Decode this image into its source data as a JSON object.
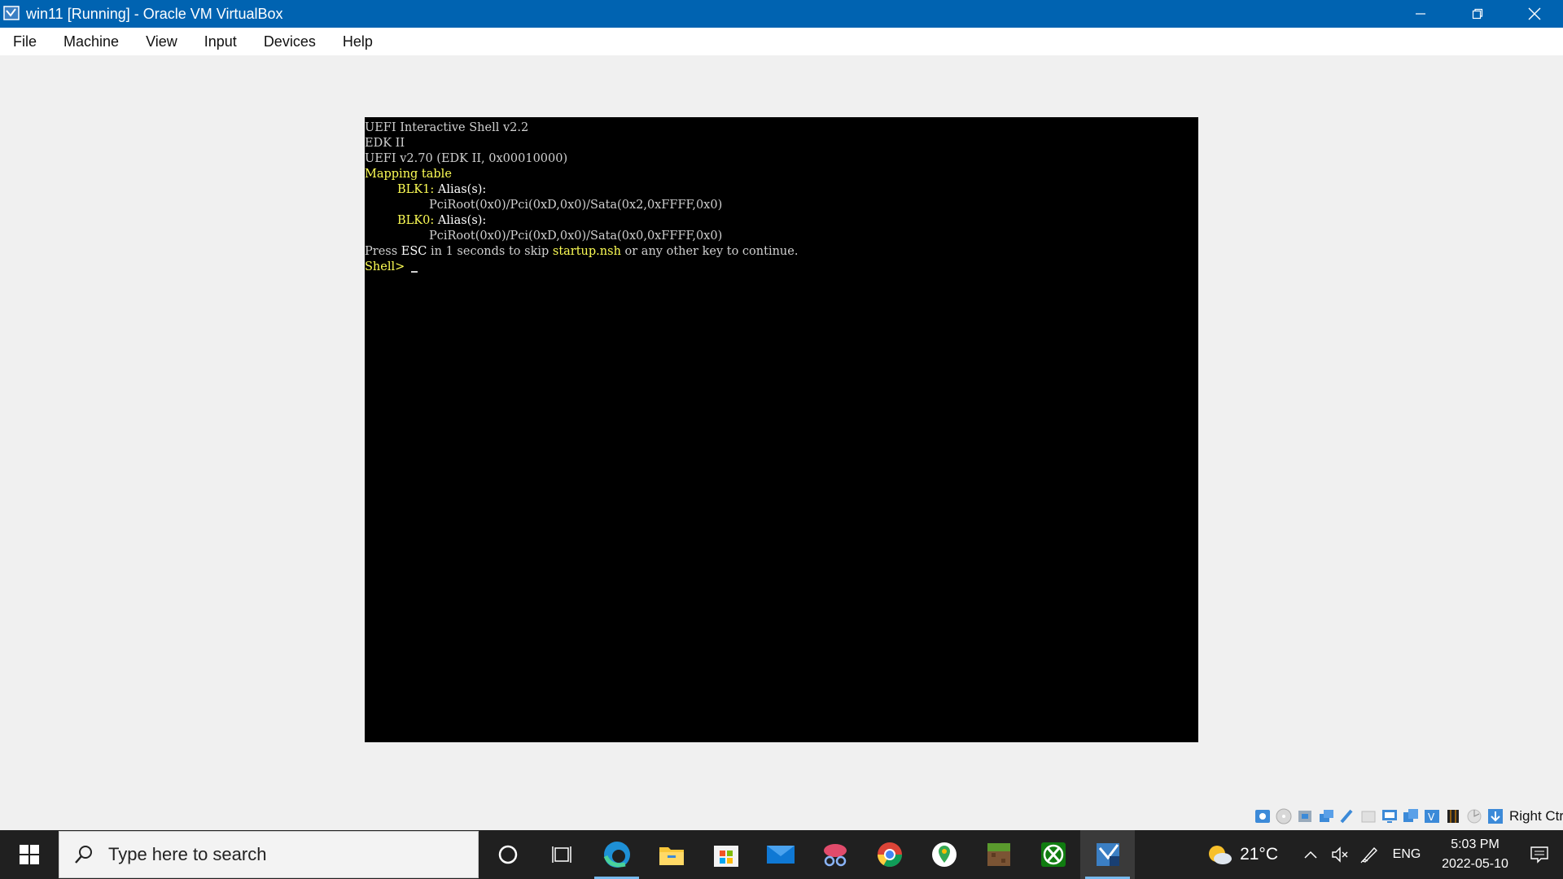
{
  "window": {
    "title": "win11 [Running] - Oracle VM VirtualBox",
    "icon": "virtualbox-icon"
  },
  "menu": [
    "File",
    "Machine",
    "View",
    "Input",
    "Devices",
    "Help"
  ],
  "console": {
    "line1": "UEFI Interactive Shell v2.2",
    "line2": "EDK II",
    "line3": "UEFI v2.70 (EDK II, 0x00010000)",
    "mapping_header": "Mapping table",
    "blk1_name": "BLK1:",
    "alias_label": " Alias(s):",
    "blk1_path": "PciRoot(0x0)/Pci(0xD,0x0)/Sata(0x2,0xFFFF,0x0)",
    "blk0_name": "BLK0:",
    "blk0_path": "PciRoot(0x0)/Pci(0xD,0x0)/Sata(0x0,0xFFFF,0x0)",
    "press": "Press ",
    "esc": "ESC",
    "in_seconds": " in 1 seconds to skip ",
    "startup": "startup.nsh",
    "continue": " or any other key to continue.",
    "prompt": "Shell>"
  },
  "status": {
    "host_key": "Right Ctrl"
  },
  "taskbar": {
    "search_placeholder": "Type here to search",
    "temperature": "21°C",
    "language": "ENG",
    "time": "5:03 PM",
    "date": "2022-05-10"
  },
  "colors": {
    "titlebar": "#0063b1",
    "console_yellow": "#ffff55",
    "taskbar": "#202020"
  }
}
